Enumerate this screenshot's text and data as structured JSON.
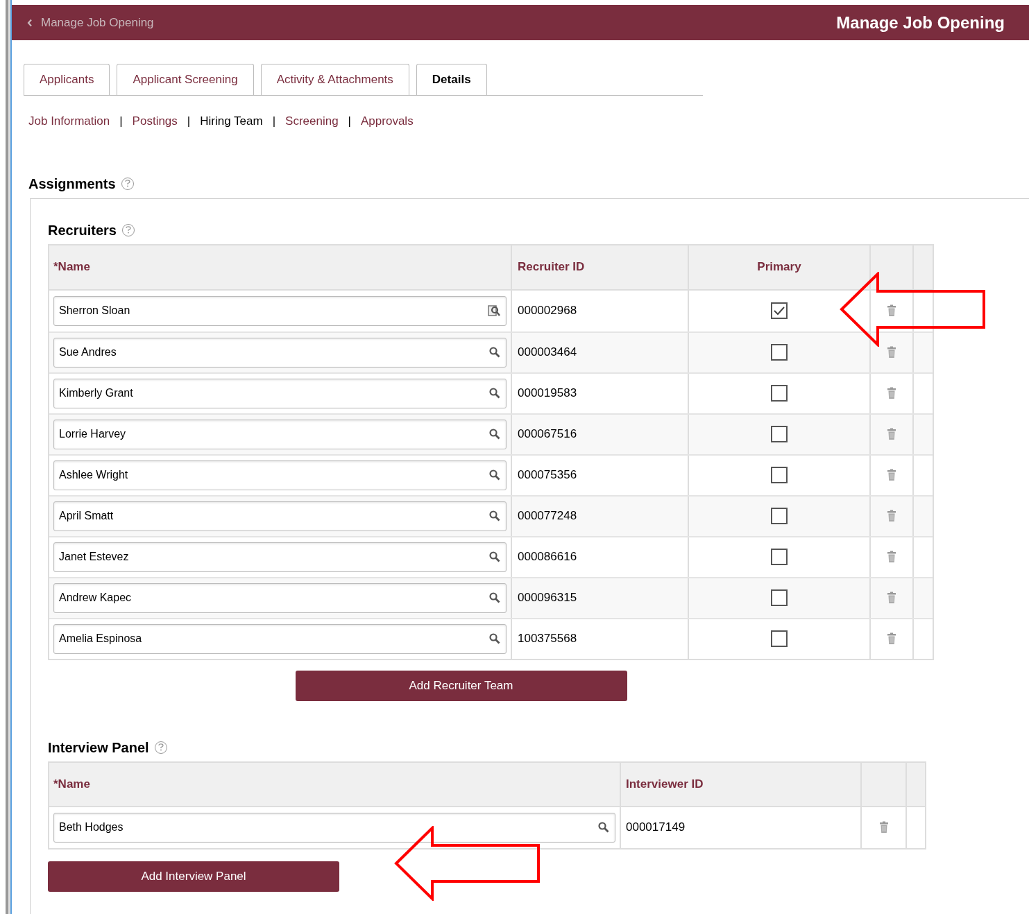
{
  "header": {
    "back_label": "Manage Job Opening",
    "title": "Manage Job Opening"
  },
  "tabs": [
    {
      "label": "Applicants",
      "selected": false
    },
    {
      "label": "Applicant Screening",
      "selected": false
    },
    {
      "label": "Activity & Attachments",
      "selected": false
    },
    {
      "label": "Details",
      "selected": true
    }
  ],
  "subnav": [
    {
      "label": "Job Information",
      "selected": false
    },
    {
      "separator": "|",
      "label": "Postings",
      "selected": false
    },
    {
      "separator": "|",
      "label": "Hiring Team",
      "selected": true
    },
    {
      "separator": "|",
      "label": "Screening",
      "selected": false
    },
    {
      "separator": "|",
      "label": "Approvals",
      "selected": false
    }
  ],
  "assignments": {
    "title": "Assignments",
    "recruiters": {
      "title": "Recruiters",
      "columns": [
        "*Name",
        "Recruiter ID",
        "Primary"
      ],
      "rows": [
        {
          "name": "Sherron Sloan",
          "kind": "lookup-page",
          "id": "000002968",
          "primary": true
        },
        {
          "name": "Sue Andres",
          "kind": "lookup",
          "id": "000003464",
          "primary": false
        },
        {
          "name": "Kimberly Grant",
          "kind": "lookup",
          "id": "000019583",
          "primary": false
        },
        {
          "name": "Lorrie Harvey",
          "kind": "lookup",
          "id": "000067516",
          "primary": false
        },
        {
          "name": "Ashlee Wright",
          "kind": "lookup",
          "id": "000075356",
          "primary": false
        },
        {
          "name": "April Smatt",
          "kind": "lookup",
          "id": "000077248",
          "primary": false
        },
        {
          "name": "Janet Estevez",
          "kind": "lookup",
          "id": "000086616",
          "primary": false
        },
        {
          "name": "Andrew Kapec",
          "kind": "lookup",
          "id": "000096315",
          "primary": false
        },
        {
          "name": "Amelia Espinosa",
          "kind": "lookup",
          "id": "100375568",
          "primary": false
        }
      ],
      "button": "Add Recruiter Team"
    },
    "interview_panel": {
      "title": "Interview Panel",
      "columns": [
        "*Name",
        "Interviewer ID"
      ],
      "rows": [
        {
          "name": "Beth Hodges",
          "kind": "lookup",
          "id": "000017149"
        }
      ],
      "button": "Add Interview Panel"
    }
  }
}
